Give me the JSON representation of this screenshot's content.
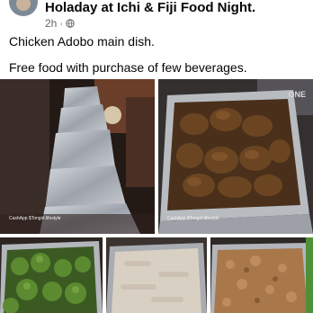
{
  "post": {
    "title": "Holaday at Ichi & Fiji Food Night.",
    "time": "2h",
    "separator": "·",
    "privacy_icon": "globe-icon",
    "text_line1": "Chicken Adobo main dish.",
    "text_line2": "Free food with purchase of few beverages."
  },
  "photos": {
    "watermark": "CashApp $Tongirl.lifestyle",
    "sign_text": "ONE"
  },
  "colors": {
    "text": "#050505",
    "meta": "#65676b",
    "foil": "#b9bcc2",
    "chicken": "#5a3a1e",
    "broccoli": "#4f7a2c",
    "rice": "#d8cfc3"
  }
}
